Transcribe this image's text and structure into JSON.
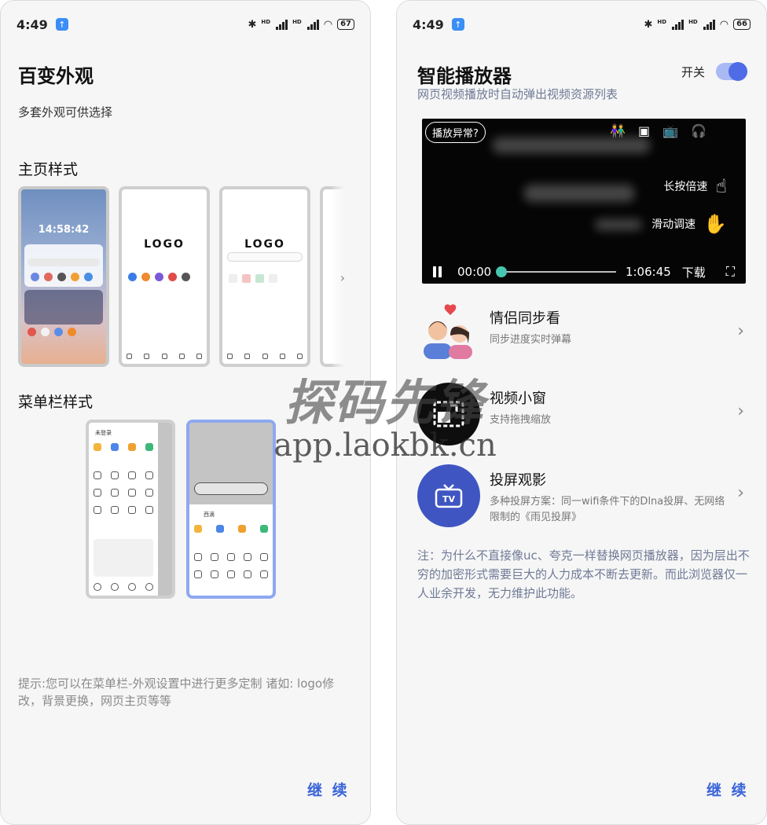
{
  "left": {
    "status": {
      "time": "4:49",
      "battery": "67"
    },
    "title": "百变外观",
    "subtitle": "多套外观可供选择",
    "home_section": "主页样式",
    "home_thumbs": {
      "clock": "14:58:42",
      "logo1": "LOGO",
      "logo2": "LOGO"
    },
    "menu_section": "菜单栏样式",
    "menu_cards": {
      "card1_user": "未登录",
      "card2_user": "西滴"
    },
    "tip": "提示:您可以在菜单栏-外观设置中进行更多定制 诸如: logo修改，背景更换，网页主页等等",
    "continue": "继 续"
  },
  "right": {
    "status": {
      "time": "4:49",
      "battery": "66"
    },
    "title": "智能播放器",
    "toggle_label": "开关",
    "toggle_on": true,
    "description": "网页视频播放时自动弹出视频资源列表",
    "player": {
      "anomaly": "播放异常?",
      "hint_long_press": "长按倍速",
      "hint_slide": "滑动调速",
      "current_time": "00:00",
      "duration": "1:06:45",
      "download": "下载"
    },
    "features": [
      {
        "title": "情侣同步看",
        "desc": "同步进度实时弹幕"
      },
      {
        "title": "视频小窗",
        "desc": "支持拖拽缩放"
      },
      {
        "title": "投屏观影",
        "desc": "多种投屏方案：同一wifi条件下的Dlna投屏、无网络限制的《雨见投屏》"
      }
    ],
    "note": "注：为什么不直接像uc、夸克一样替换网页播放器，因为层出不穷的加密形式需要巨大的人力成本不断去更新。而此浏览器仅一人业余开发，无力维护此功能。",
    "continue": "继 续"
  },
  "watermark": {
    "text": "探码先锋",
    "url": "app.laokbk.cn"
  },
  "colors": {
    "accent": "#3a64d8",
    "toggle": "#4f6ce6",
    "icon_circle": "#3f56c2"
  }
}
